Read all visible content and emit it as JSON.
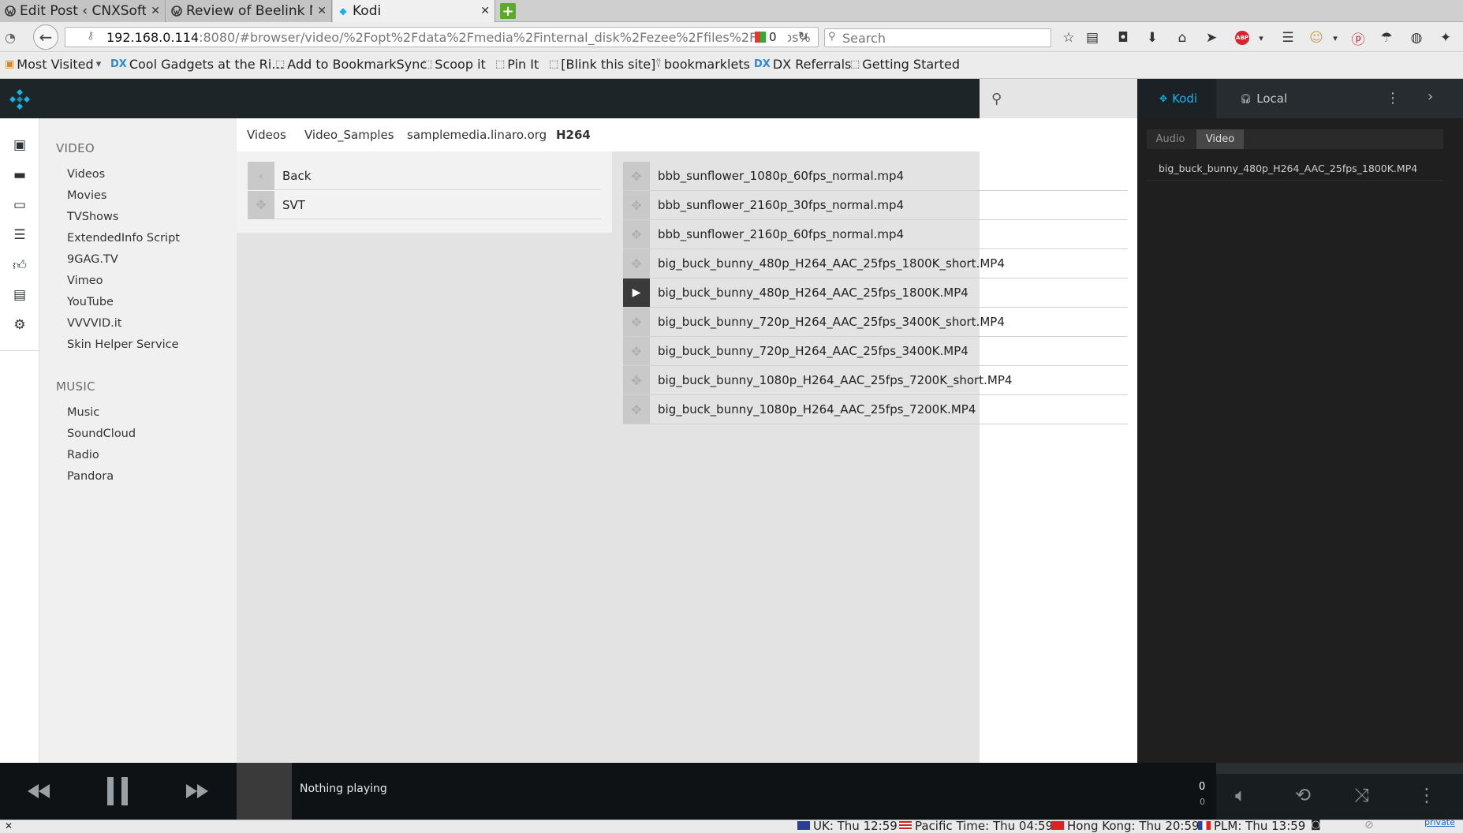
{
  "browser": {
    "tabs": [
      {
        "title": "Edit Post ‹ CNXSoft -…",
        "favicon": "wordpress-icon"
      },
      {
        "title": "Review of Beelink MI…",
        "favicon": "wordpress-icon"
      },
      {
        "title": "Kodi",
        "favicon": "kodi-icon"
      }
    ],
    "url_host": "192.168.0.114",
    "url_rest": ":8080/#browser/video/%2Fopt%2Fdata%2Fmedia%2Finternal_disk%2Fezee%2Ffiles%2FVideos%",
    "ext_count": "0",
    "search_placeholder": "Search",
    "bookmarks": [
      "Most Visited",
      "Cool Gadgets at the Ri…",
      "Add to BookmarkSync",
      "Scoop it",
      "Pin It",
      "[Blink this site]",
      "bookmarklets",
      "DX Referrals",
      "Getting Started"
    ]
  },
  "kodi": {
    "search_icon": "search-icon",
    "sidebar_icons": [
      "library-icon",
      "movies-icon",
      "tv-icon",
      "playlist-icon",
      "thumbs-up-icon",
      "clipboard-icon",
      "settings-icon"
    ],
    "nav": {
      "video_heading": "VIDEO",
      "video_items": [
        "Videos",
        "Movies",
        "TVShows",
        "ExtendedInfo Script",
        "9GAG.TV",
        "Vimeo",
        "YouTube",
        "VVVVID.it",
        "Skin Helper Service"
      ],
      "music_heading": "MUSIC",
      "music_items": [
        "Music",
        "SoundCloud",
        "Radio",
        "Pandora"
      ]
    },
    "breadcrumbs": [
      "Videos",
      "Video_Samples",
      "samplemedia.linaro.org",
      "H264"
    ],
    "folders": [
      "Back",
      "SVT"
    ],
    "files": [
      "bbb_sunflower_1080p_60fps_normal.mp4",
      "bbb_sunflower_2160p_30fps_normal.mp4",
      "bbb_sunflower_2160p_60fps_normal.mp4",
      "big_buck_bunny_480p_H264_AAC_25fps_1800K_short.MP4",
      "big_buck_bunny_480p_H264_AAC_25fps_1800K.MP4",
      "big_buck_bunny_720p_H264_AAC_25fps_3400K_short.MP4",
      "big_buck_bunny_720p_H264_AAC_25fps_3400K.MP4",
      "big_buck_bunny_1080p_H264_AAC_25fps_7200K_short.MP4",
      "big_buck_bunny_1080p_H264_AAC_25fps_7200K.MP4"
    ],
    "playing_index": 4,
    "right_panel": {
      "kodi_tab": "Kodi",
      "local_tab": "Local",
      "audio_tab": "Audio",
      "video_tab": "Video",
      "playlist_item": "big_buck_bunny_480p_H264_AAC_25fps_1800K.MP4"
    },
    "player": {
      "status": "Nothing playing",
      "count_top": "0",
      "count_bottom": "0"
    },
    "accent": "#17b2e7"
  },
  "statusbar": {
    "clocks": [
      "UK: Thu 12:59",
      "Pacific Time: Thu 04:59",
      "Hong Kong: Thu 20:59",
      "PLM: Thu 13:59"
    ],
    "private_label": "private"
  }
}
